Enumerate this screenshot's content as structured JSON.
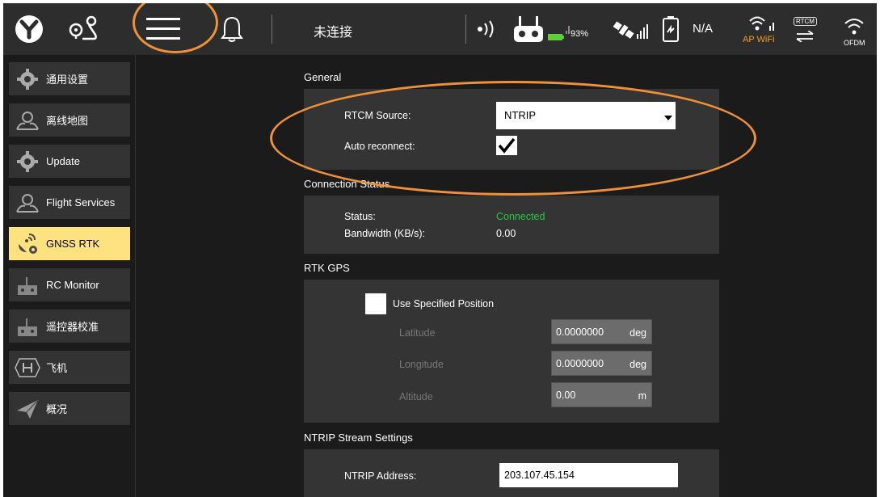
{
  "topbar": {
    "connection_status": "未连接",
    "battery_percent": "93%",
    "gps_value": "N/A",
    "wifi_label": "AP WiFi",
    "rtcm_badge": "RTCM",
    "ofdm_label": "OFDM",
    "accent_color": "#f0a020"
  },
  "sidebar": {
    "items": [
      {
        "label": "通用设置",
        "icon": "gear-icon"
      },
      {
        "label": "离线地图",
        "icon": "map-pin-icon"
      },
      {
        "label": "Update",
        "icon": "gear-icon"
      },
      {
        "label": "Flight Services",
        "icon": "map-pin-icon"
      },
      {
        "label": "GNSS RTK",
        "icon": "satellite-icon",
        "active": true
      },
      {
        "label": "RC Monitor",
        "icon": "remote-controller-icon"
      },
      {
        "label": "遥控器校准",
        "icon": "remote-controller-icon"
      },
      {
        "label": "飞机",
        "icon": "helipad-icon"
      },
      {
        "label": "概况",
        "icon": "paper-plane-icon"
      }
    ],
    "active_color": "#fde27f"
  },
  "general": {
    "title": "General",
    "rtcm_source_label": "RTCM Source:",
    "rtcm_source_value": "NTRIP",
    "auto_reconnect_label": "Auto reconnect:",
    "auto_reconnect_checked": true
  },
  "connection_status": {
    "title": "Connection Status",
    "status_label": "Status:",
    "status_value": "Connected",
    "status_color": "#22cc44",
    "bandwidth_label": "Bandwidth (KB/s):",
    "bandwidth_value": "0.00"
  },
  "rtk_gps": {
    "title": "RTK GPS",
    "use_specified_label": "Use Specified Position",
    "use_specified_checked": false,
    "latitude_label": "Latitude",
    "latitude_value": "0.0000000",
    "latitude_unit": "deg",
    "longitude_label": "Longitude",
    "longitude_value": "0.0000000",
    "longitude_unit": "deg",
    "altitude_label": "Altitude",
    "altitude_value": "0.00",
    "altitude_unit": "m"
  },
  "ntrip": {
    "title": "NTRIP Stream Settings",
    "address_label": "NTRIP Address:",
    "address_value": "203.107.45.154"
  },
  "annotation_color": "#f0913a"
}
